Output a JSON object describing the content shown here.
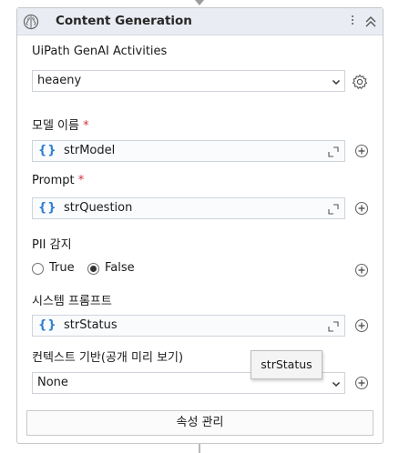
{
  "activity": {
    "title": "Content Generation",
    "connection_label": "UiPath GenAI Activities",
    "connection_value": "heaeny",
    "fields": {
      "model": {
        "label": "모델 이름",
        "required_mark": "*",
        "braces": "{}",
        "value": "strModel"
      },
      "prompt": {
        "label": "Prompt",
        "required_mark": "*",
        "braces": "{}",
        "value": "strQuestion"
      },
      "pii": {
        "label": "PII 감지",
        "option_true": "True",
        "option_false": "False",
        "selected": "False"
      },
      "system_prompt": {
        "label": "시스템 프롬프트",
        "braces": "{}",
        "value": "strStatus"
      },
      "context": {
        "label": "컨텍스트 기반(공개 미리 보기)",
        "value": "None"
      }
    },
    "manage_button": "속성 관리",
    "tooltip": "strStatus"
  },
  "colors": {
    "header_bg": "#e9ecf2",
    "accent_blue": "#2f7fd1",
    "required_red": "#d13438"
  },
  "icons": [
    "brain-icon",
    "more-vertical-icon",
    "collapse-icon",
    "dropdown-chevron-icon",
    "settings-gear-icon",
    "expand-editor-icon",
    "plus-circle-icon"
  ]
}
